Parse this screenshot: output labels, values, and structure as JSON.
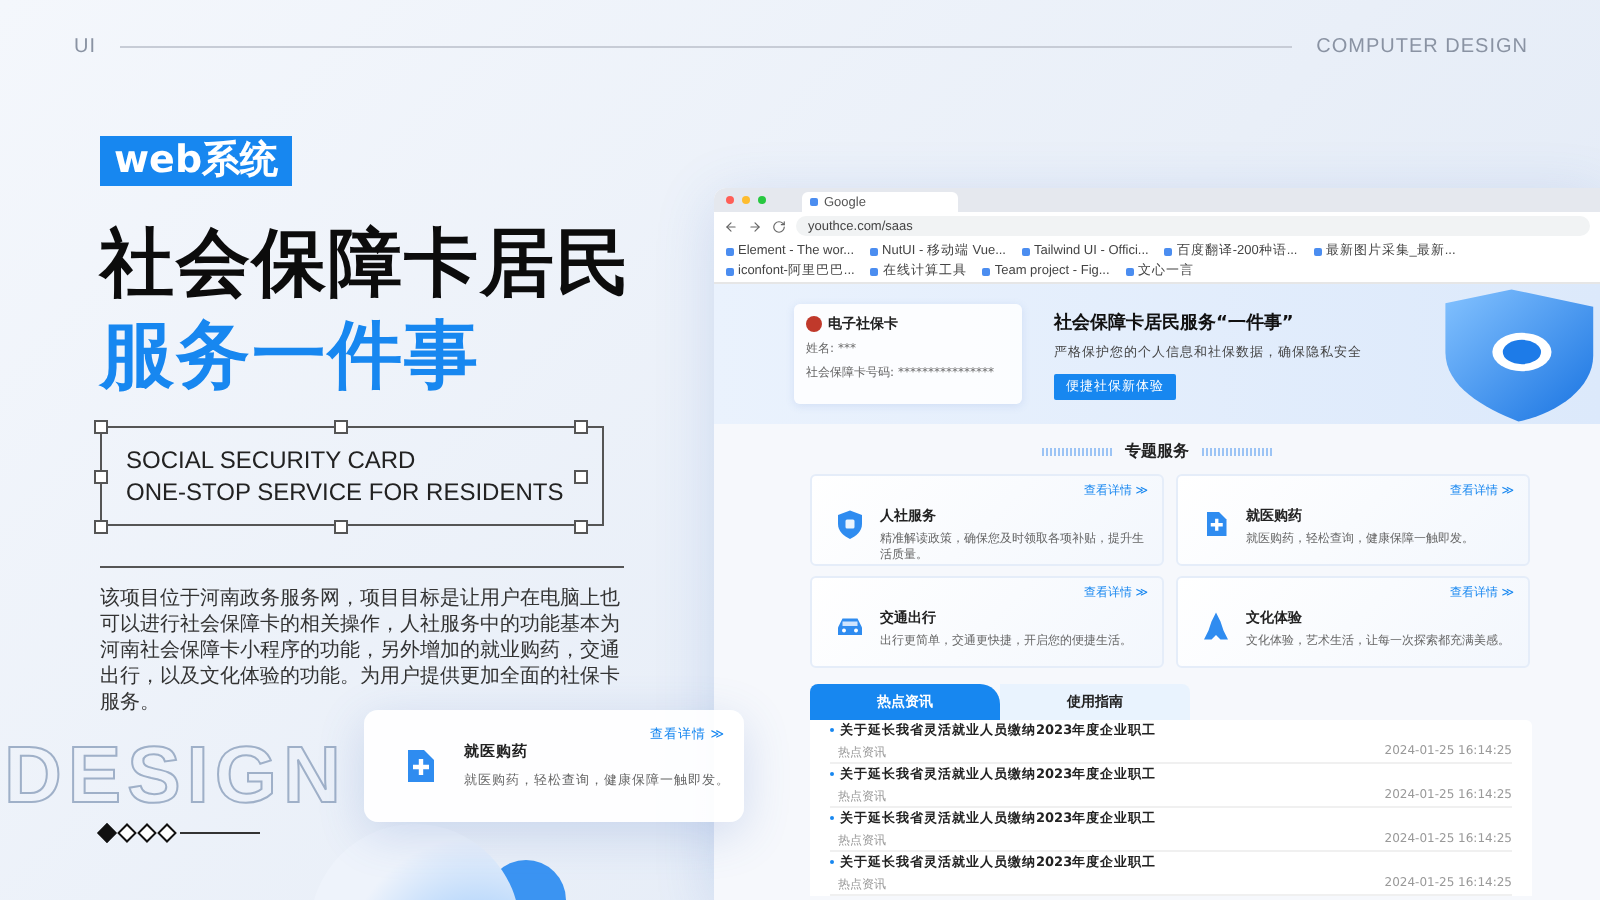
{
  "header": {
    "left": "UI",
    "right": "COMPUTER DESIGN"
  },
  "badge": "web系统",
  "title_lines": [
    {
      "text": "社会保障卡居民",
      "kind": "dark"
    },
    {
      "text": "服务一件事",
      "kind": "accent"
    }
  ],
  "subtitle_lines": [
    "SOCIAL SECURITY CARD",
    "ONE-STOP SERVICE FOR RESIDENTS"
  ],
  "description": "该项目位于河南政务服务网，项目目标是让用户在电脑上也可以进行社会保障卡的相关操作，人社服务中的功能基本为河南社会保障卡小程序的功能，另外增加的就业购药，交通出行，以及文化体验的功能。为用户提供更加全面的社保卡服务。",
  "background_word": "DESIGN",
  "pager": [
    {
      "selected": true
    },
    {
      "selected": false
    },
    {
      "selected": false
    },
    {
      "selected": false
    }
  ],
  "floating_card": {
    "kind": "medical",
    "title": "就医购药",
    "text": "就医购药，轻松查询，健康保障一触即发。",
    "link": "查看详情 ≫"
  },
  "browser": {
    "tab": "Google",
    "url": "youthce.com/saas",
    "bookmarks": [
      "Element - The wor...",
      "NutUI - 移动端 Vue...",
      "Tailwind UI - Offici...",
      "百度翻译-200种语...",
      "最新图片采集_最新...",
      "iconfont-阿里巴巴...",
      "在线计算工具",
      "Team project - Fig...",
      "文心一言"
    ]
  },
  "hero": {
    "card": {
      "title": "电子社保卡",
      "fields": [
        {
          "label": "姓名:",
          "value": "***"
        },
        {
          "label": "社会保障卡号码:",
          "value": "****************"
        }
      ]
    },
    "heading": "社会保障卡居民服务“一件事”",
    "subheading": "严格保护您的个人信息和社保数据，确保隐私安全",
    "button": "便捷社保新体验"
  },
  "section_title": "专题服务",
  "services": [
    {
      "kind": "shield",
      "title": "人社服务",
      "text": "精准解读政策，确保您及时领取各项补贴，提升生活质量。",
      "link": "查看详情 ≫"
    },
    {
      "kind": "medical",
      "title": "就医购药",
      "text": "就医购药，轻松查询，健康保障一触即发。",
      "link": "查看详情 ≫"
    },
    {
      "kind": "car",
      "title": "交通出行",
      "text": "出行更简单，交通更快捷，开启您的便捷生活。",
      "link": "查看详情 ≫"
    },
    {
      "kind": "tower",
      "title": "文化体验",
      "text": "文化体验，艺术生活，让每一次探索都充满美感。",
      "link": "查看详情 ≫"
    }
  ],
  "news_tabs": [
    {
      "label": "热点资讯",
      "selected": true
    },
    {
      "label": "使用指南",
      "selected": false
    }
  ],
  "news": [
    {
      "title": "关于延长我省灵活就业人员缴纳2023年度企业职工",
      "tag": "热点资讯",
      "time": "2024-01-25  16:14:25"
    },
    {
      "title": "关于延长我省灵活就业人员缴纳2023年度企业职工",
      "tag": "热点资讯",
      "time": "2024-01-25  16:14:25"
    },
    {
      "title": "关于延长我省灵活就业人员缴纳2023年度企业职工",
      "tag": "热点资讯",
      "time": "2024-01-25  16:14:25"
    },
    {
      "title": "关于延长我省灵活就业人员缴纳2023年度企业职工",
      "tag": "热点资讯",
      "time": "2024-01-25  16:14:25"
    }
  ]
}
